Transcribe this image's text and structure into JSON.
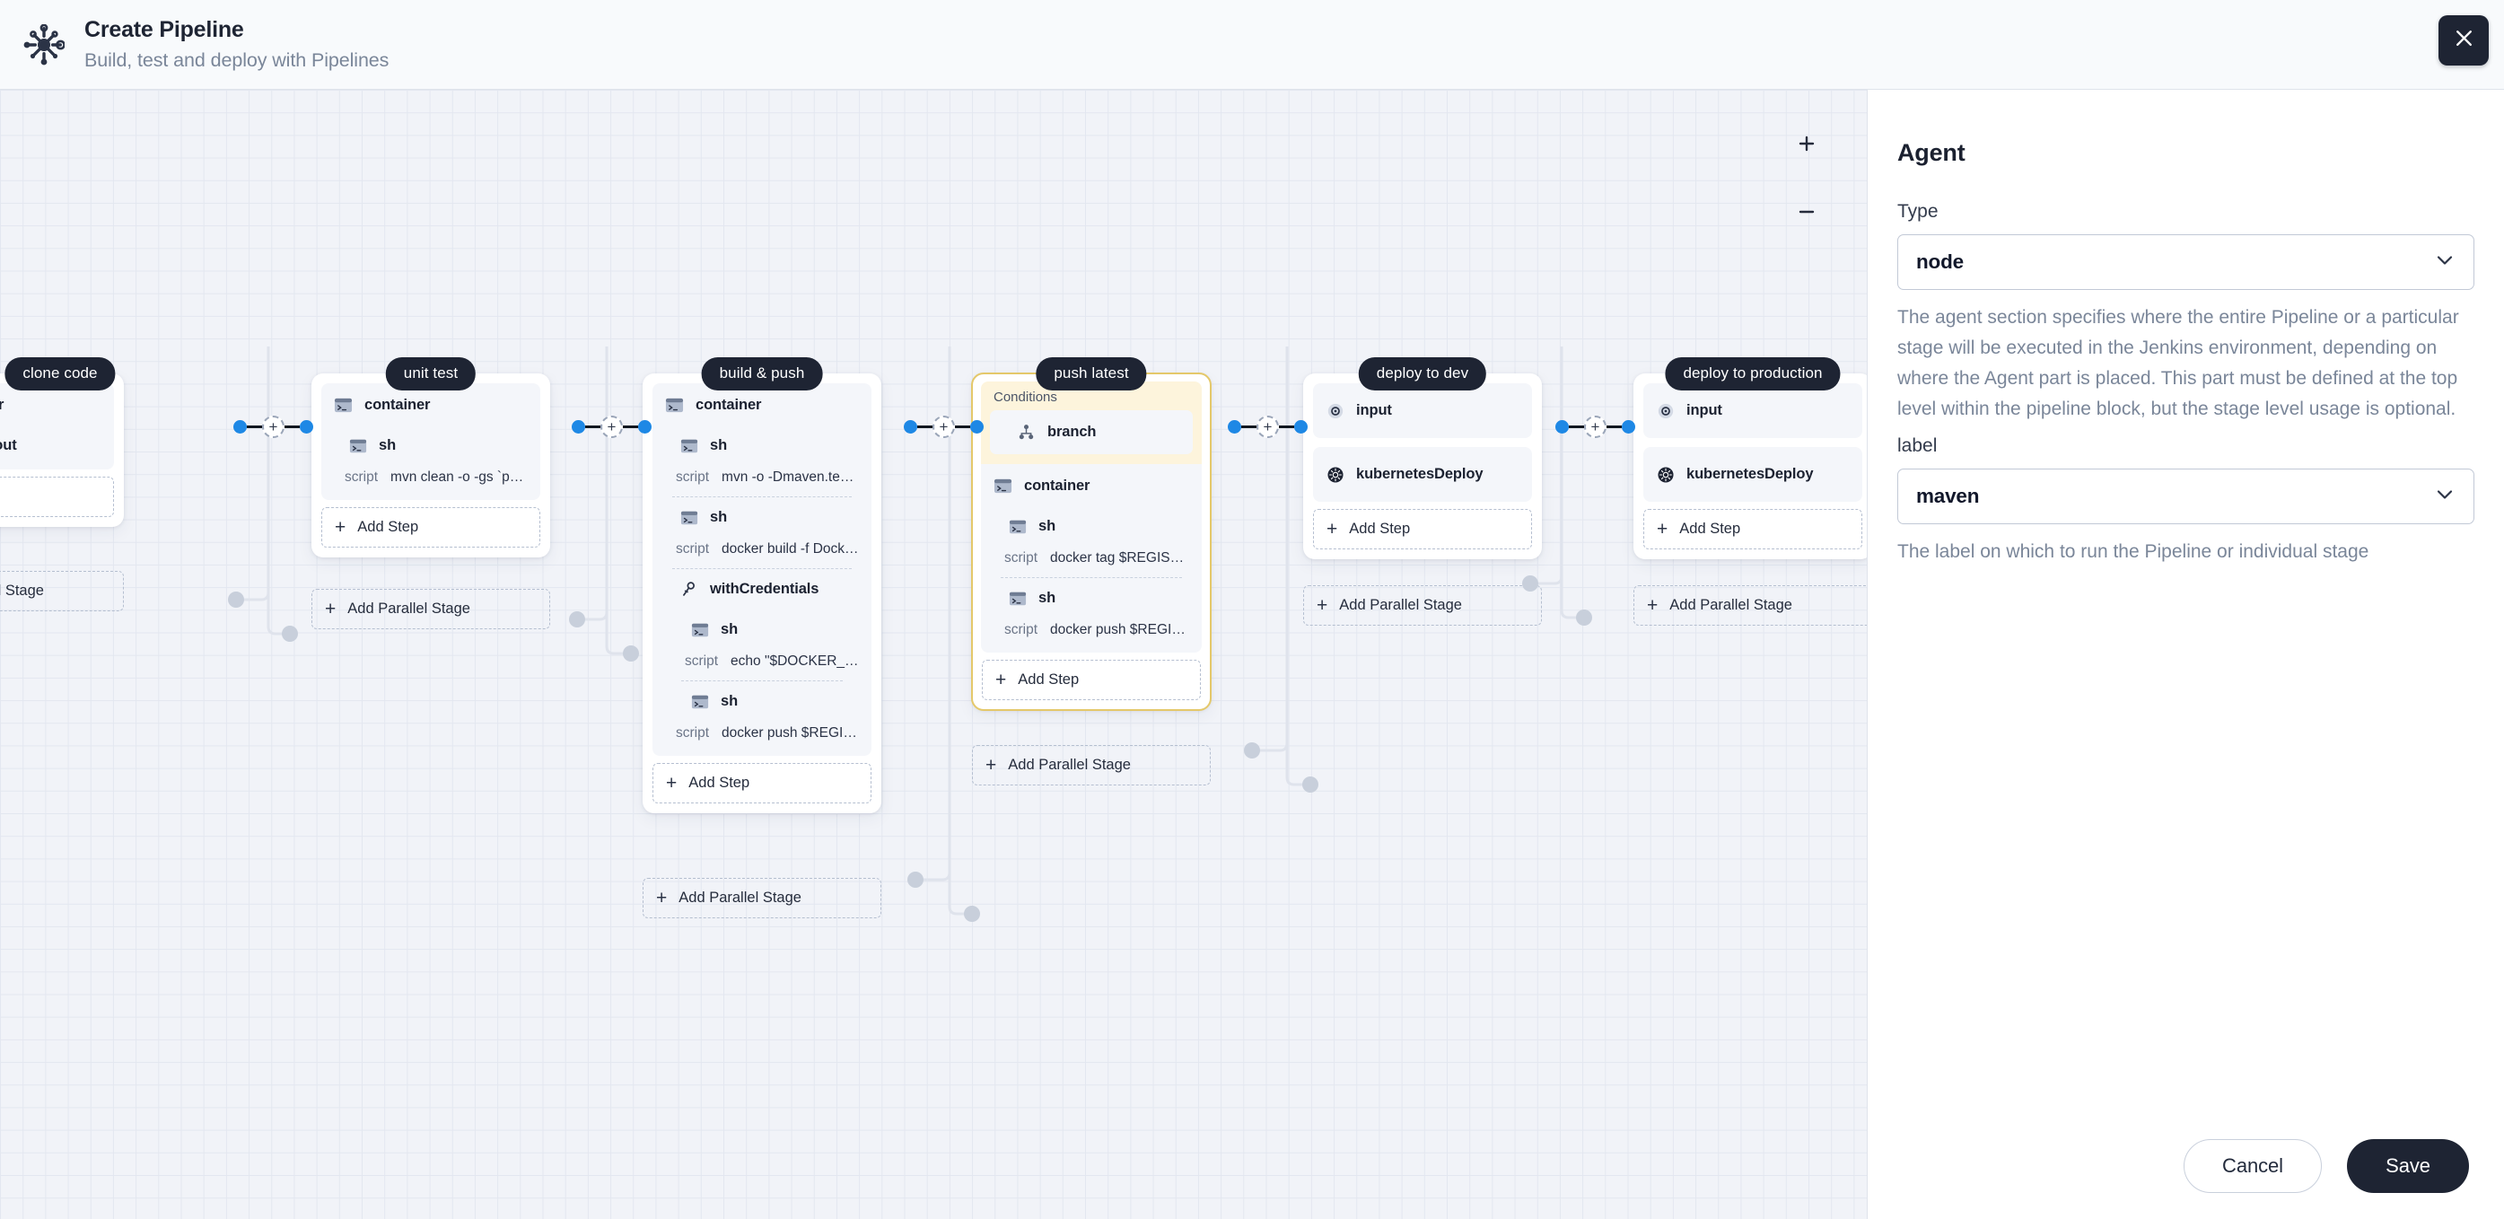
{
  "header": {
    "logo_icon": "jenkins-pipeline-icon",
    "title": "Create Pipeline",
    "subtitle": "Build, test and deploy with Pipelines",
    "close_icon": "close-icon"
  },
  "canvas": {
    "zoom_in_label": "+",
    "zoom_out_label": "−",
    "add_step_label": "Add Step",
    "add_parallel_label": "Add Parallel Stage",
    "plus_node_label": "+",
    "conditions_label": "Conditions",
    "script_key": "script",
    "colors": {
      "grid_bg": "#f1f3f8",
      "grid_line": "#e3e7f0",
      "stage_label_bg": "#1e2433",
      "connector_dot": "#1e88e5",
      "conditions_bg": "#fdf4dc",
      "selection_outline": "#e4c86a"
    }
  },
  "stages": [
    {
      "name": "clone code",
      "selected": false,
      "steps": [
        {
          "icon": "terminal-icon",
          "name": "container",
          "script": null
        },
        {
          "icon": "branch-icon",
          "name": "checkout",
          "script": null
        }
      ]
    },
    {
      "name": "unit test",
      "selected": false,
      "steps": [
        {
          "icon": "terminal-icon",
          "name": "container",
          "script": null
        },
        {
          "icon": "terminal-icon",
          "name": "sh",
          "script": "mvn clean -o -gs `pwd`/..."
        }
      ]
    },
    {
      "name": "build & push",
      "selected": false,
      "steps": [
        {
          "icon": "terminal-icon",
          "name": "container",
          "script": null
        },
        {
          "icon": "terminal-icon",
          "name": "sh",
          "script": "mvn -o -Dmaven.test.ski..."
        },
        {
          "icon": "terminal-icon",
          "name": "sh",
          "script": "docker build -f Dockerfil..."
        },
        {
          "icon": "key-icon",
          "name": "withCredentials",
          "script": null
        },
        {
          "icon": "terminal-icon",
          "name": "sh",
          "script": "echo \"$DOCKER_PAS..."
        },
        {
          "icon": "terminal-icon",
          "name": "sh",
          "script": "docker push $REGIST..."
        }
      ]
    },
    {
      "name": "push latest",
      "selected": true,
      "conditions": [
        {
          "icon": "branch-icon",
          "name": "branch"
        }
      ],
      "steps": [
        {
          "icon": "terminal-icon",
          "name": "container",
          "script": null
        },
        {
          "icon": "terminal-icon",
          "name": "sh",
          "script": "docker tag $REGISTRY/..."
        },
        {
          "icon": "terminal-icon",
          "name": "sh",
          "script": "docker push $REGISTRY..."
        }
      ]
    },
    {
      "name": "deploy to dev",
      "selected": false,
      "steps": [
        {
          "icon": "input-icon",
          "name": "input",
          "script": null
        },
        {
          "icon": "kubernetes-icon",
          "name": "kubernetesDeploy",
          "script": null
        }
      ]
    },
    {
      "name": "deploy to production",
      "selected": false,
      "steps": [
        {
          "icon": "input-icon",
          "name": "input",
          "script": null
        },
        {
          "icon": "kubernetes-icon",
          "name": "kubernetesDeploy",
          "script": null
        }
      ]
    }
  ],
  "panel": {
    "title": "Agent",
    "type_label": "Type",
    "type_value": "node",
    "type_help": "The agent section specifies where the entire Pipeline or a particular stage will be executed in the Jenkins environment, depending on where the Agent part is placed. This part must be defined at the top level within the pipeline block, but the stage level usage is optional.",
    "label_label": "label",
    "label_value": "maven",
    "label_help": "The label on which to run the Pipeline or individual stage",
    "chevron_icon": "chevron-down-icon",
    "cancel_label": "Cancel",
    "save_label": "Save"
  }
}
